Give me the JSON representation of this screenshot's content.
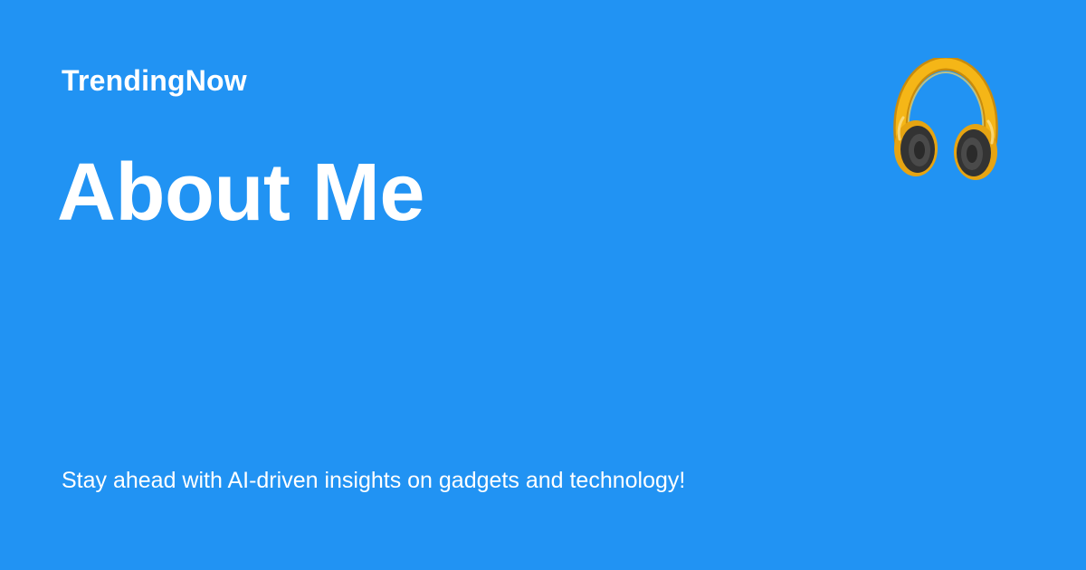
{
  "header": {
    "brand": "TrendingNow",
    "icon": "headphones-icon"
  },
  "main": {
    "title": "About Me",
    "tagline": "Stay ahead with AI-driven insights on gadgets and technology!"
  },
  "colors": {
    "background": "#2193f3",
    "text": "#ffffff",
    "headphone_band": "#f5b617",
    "headphone_cup": "#3a3a3a"
  }
}
